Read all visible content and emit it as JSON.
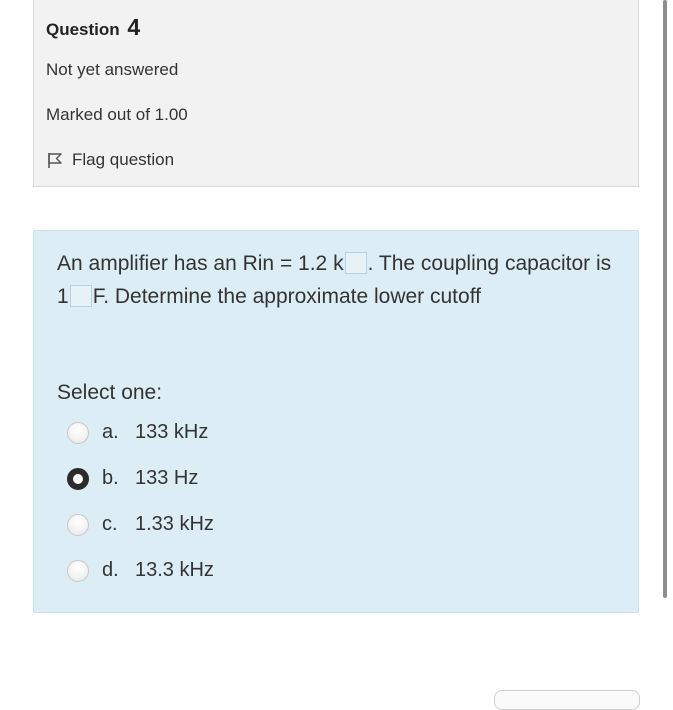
{
  "question": {
    "label": "Question",
    "number": "4",
    "state": "Not yet answered",
    "marks": "Marked out of 1.00",
    "flag_label": "Flag question",
    "flag_icon": "flag-icon"
  },
  "question_text": {
    "part1": "An amplifier has an Rin = 1.2 k",
    "part2": ". The coupling capacitor is 1",
    "part3": "F. Determine the approximate lower cutoff"
  },
  "answer": {
    "prompt": "Select one:",
    "options": [
      {
        "letter": "a.",
        "text": "133 kHz",
        "selected": false
      },
      {
        "letter": "b.",
        "text": "133 Hz",
        "selected": true
      },
      {
        "letter": "c.",
        "text": "1.33 kHz",
        "selected": false
      },
      {
        "letter": "d.",
        "text": "13.3 kHz",
        "selected": false
      }
    ]
  },
  "colors": {
    "info_bg": "#f2f2f2",
    "content_bg": "#dcedf5",
    "text": "#333333"
  }
}
